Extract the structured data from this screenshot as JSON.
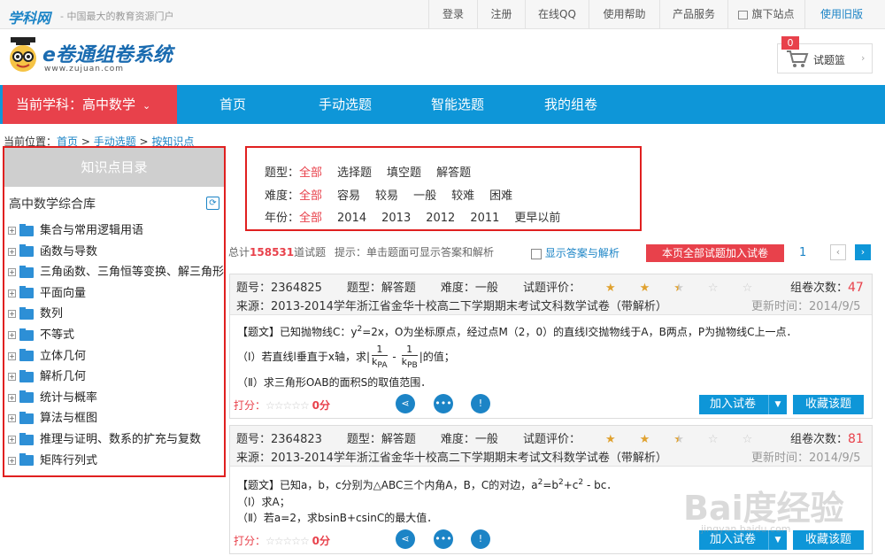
{
  "topbar": {
    "brand": "学科网",
    "slogan": "- 中国最大的教育资源门户",
    "links": [
      "登录",
      "注册",
      "在线QQ",
      "使用帮助",
      "产品服务",
      "旗下站点",
      "使用旧版"
    ]
  },
  "logo": {
    "title": "e卷通组卷系统",
    "url": "www.zujuan.com"
  },
  "cart": {
    "count": "0",
    "label": "试题篮"
  },
  "nav": {
    "subject": "当前学科：高中数学",
    "items": [
      "首页",
      "手动选题",
      "智能选题",
      "我的组卷"
    ]
  },
  "breadcrumb": {
    "prefix": "当前位置：",
    "items": [
      "首页",
      "手动选题",
      "按知识点"
    ],
    "sep": " > "
  },
  "knowledge_tree": {
    "header": "知识点目录",
    "root": "高中数学综合库",
    "items": [
      "集合与常用逻辑用语",
      "函数与导数",
      "三角函数、三角恒等变换、解三角形",
      "平面向量",
      "数列",
      "不等式",
      "立体几何",
      "解析几何",
      "统计与概率",
      "算法与框图",
      "推理与证明、数系的扩充与复数",
      "矩阵行列式"
    ]
  },
  "filters": {
    "type": {
      "label": "题型：",
      "options": [
        "全部",
        "选择题",
        "填空题",
        "解答题"
      ],
      "selected": "全部"
    },
    "difficulty": {
      "label": "难度：",
      "options": [
        "全部",
        "容易",
        "较易",
        "一般",
        "较难",
        "困难"
      ],
      "selected": "全部"
    },
    "year": {
      "label": "年份：",
      "options": [
        "全部",
        "2014",
        "2013",
        "2012",
        "2011",
        "更早以前"
      ],
      "selected": "全部"
    }
  },
  "stats": {
    "total_prefix": "总计",
    "total": "158531",
    "total_suffix": "道试题",
    "hint": "提示：单击题面可显示答案和解析",
    "show_answer": "显示答案与解析",
    "add_all": "本页全部试题加入试卷",
    "page": "1"
  },
  "questions": [
    {
      "id_label": "题号：2364825",
      "type_label": "题型：解答题",
      "difficulty_label": "难度：一般",
      "rating_label": "试题评价：",
      "rating": 2.5,
      "count_label": "组卷次数：",
      "count": "47",
      "source": "来源：2013-2014学年浙江省金华十校高二下学期期末考试文科数学试卷（带解析）",
      "updated": "更新时间：2014/9/5",
      "body": {
        "line1a": "【题文】已知抛物线C：y",
        "line1b": "=2x，O为坐标原点，经过点M（2，0）的直线l交抛物线于A，B两点，P为抛物线C上一点．",
        "sup": "2",
        "line2a": "（Ⅰ）若直线l垂直于x轴，求|",
        "frac1_num": "1",
        "frac1_den": "k",
        "frac1_sub": "PA",
        "minus": " - ",
        "frac2_num": "1",
        "frac2_den": "k",
        "frac2_sub": "PB",
        "line2b": "|的值；",
        "line3": "（Ⅱ）求三角形OAB的面积S的取值范围．"
      },
      "score_label": "打分：",
      "score": "0分",
      "add_label": "加入试卷",
      "fav_label": "收藏该题"
    },
    {
      "id_label": "题号：2364823",
      "type_label": "题型：解答题",
      "difficulty_label": "难度：一般",
      "rating_label": "试题评价：",
      "rating": 2.5,
      "count_label": "组卷次数：",
      "count": "81",
      "source": "来源：2013-2014学年浙江省金华十校高二下学期期末考试文科数学试卷（带解析）",
      "updated": "更新时间：2014/9/5",
      "body": {
        "line1a": "【题文】已知a，b，c分别为△ABC三个内角A，B，C的对边，a",
        "sup1": "2",
        "line1b": "=b",
        "sup2": "2",
        "line1c": "+c",
        "sup3": "2",
        "line1d": " - bc．",
        "line2": "（Ⅰ）求A；",
        "line3": "（Ⅱ）若a=2，求bsinB+csinC的最大值．"
      },
      "score_label": "打分：",
      "score": "0分",
      "add_label": "加入试卷",
      "fav_label": "收藏该题"
    }
  ],
  "watermark": {
    "text": "Bai度经验",
    "url": "jingyan.baidu.com"
  }
}
